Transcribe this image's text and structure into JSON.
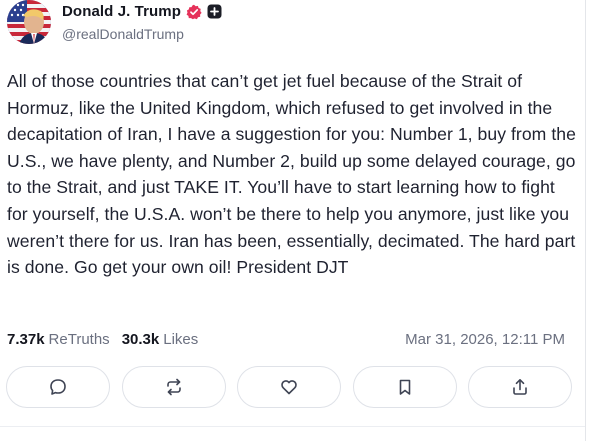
{
  "author": {
    "display_name": "Donald J. Trump",
    "handle": "@realDonaldTrump",
    "avatar_icon": "avatar-flag-portrait",
    "verified_icon": "verified-badge-icon",
    "verified_color": "#e5325a",
    "plus_icon": "plus-badge-icon"
  },
  "post": {
    "text": "All of those countries that can’t get jet fuel because of the Strait of Hormuz, like the United Kingdom, which refused to get involved in the decapitation of Iran, I have a suggestion for you: Number 1, buy from the U.S., we have plenty, and Number 2, build up some delayed courage, go to the Strait, and just TAKE IT. You’ll have to start learning how to fight for yourself, the U.S.A. won’t be there to help you anymore, just like you weren’t there for us. Iran has been, essentially, decimated. The hard part is done. Go get your own oil! President DJT"
  },
  "stats": {
    "retruths_count": "7.37k",
    "retruths_label": "ReTruths",
    "likes_count": "30.3k",
    "likes_label": "Likes",
    "timestamp": "Mar 31, 2026, 12:11 PM"
  },
  "actions": [
    {
      "name": "reply",
      "icon": "comment-icon"
    },
    {
      "name": "retruth",
      "icon": "repost-icon"
    },
    {
      "name": "like",
      "icon": "heart-icon"
    },
    {
      "name": "bookmark",
      "icon": "bookmark-icon"
    },
    {
      "name": "share",
      "icon": "share-icon"
    }
  ],
  "colors": {
    "text": "#1f2230",
    "muted": "#6b7080",
    "border": "#dfe2e8"
  }
}
